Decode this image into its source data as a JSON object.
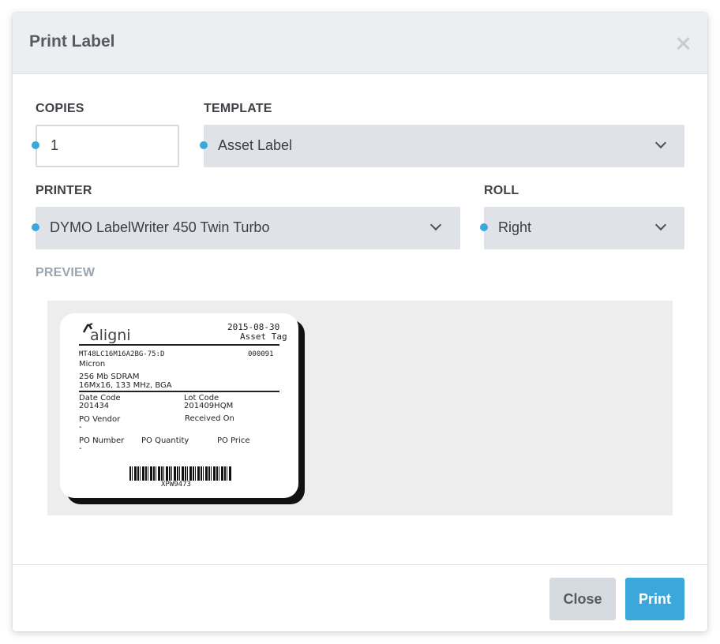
{
  "dialog": {
    "title": "Print Label"
  },
  "copies": {
    "label": "COPIES",
    "value": "1"
  },
  "template": {
    "label": "TEMPLATE",
    "value": "Asset Label"
  },
  "printer": {
    "label": "PRINTER",
    "value": "DYMO LabelWriter 450 Twin Turbo"
  },
  "roll": {
    "label": "ROLL",
    "value": "Right"
  },
  "preview": {
    "label": "PREVIEW",
    "logo_text": "aligni",
    "date": "2015-08-30",
    "tag_title": "Asset Tag",
    "part_number": "MT48LC16M16A2BG-75:D",
    "serial": "000091",
    "manufacturer": "Micron",
    "description_line1": "256 Mb SDRAM",
    "description_line2": "16Mx16, 133 MHz, BGA",
    "date_code_label": "Date Code",
    "date_code_value": "201434",
    "lot_code_label": "Lot Code",
    "lot_code_value": "201409HQM",
    "po_vendor_label": "PO Vendor",
    "po_vendor_value": "-",
    "received_on_label": "Received On",
    "po_number_label": "PO Number",
    "po_number_value": "-",
    "po_quantity_label": "PO Quantity",
    "po_price_label": "PO Price",
    "barcode_text": "XPW9473"
  },
  "footer": {
    "close_label": "Close",
    "print_label": "Print"
  },
  "colors": {
    "accent": "#3ba8dc",
    "select_bg": "#dfe3e8",
    "header_bg": "#eceef1"
  }
}
